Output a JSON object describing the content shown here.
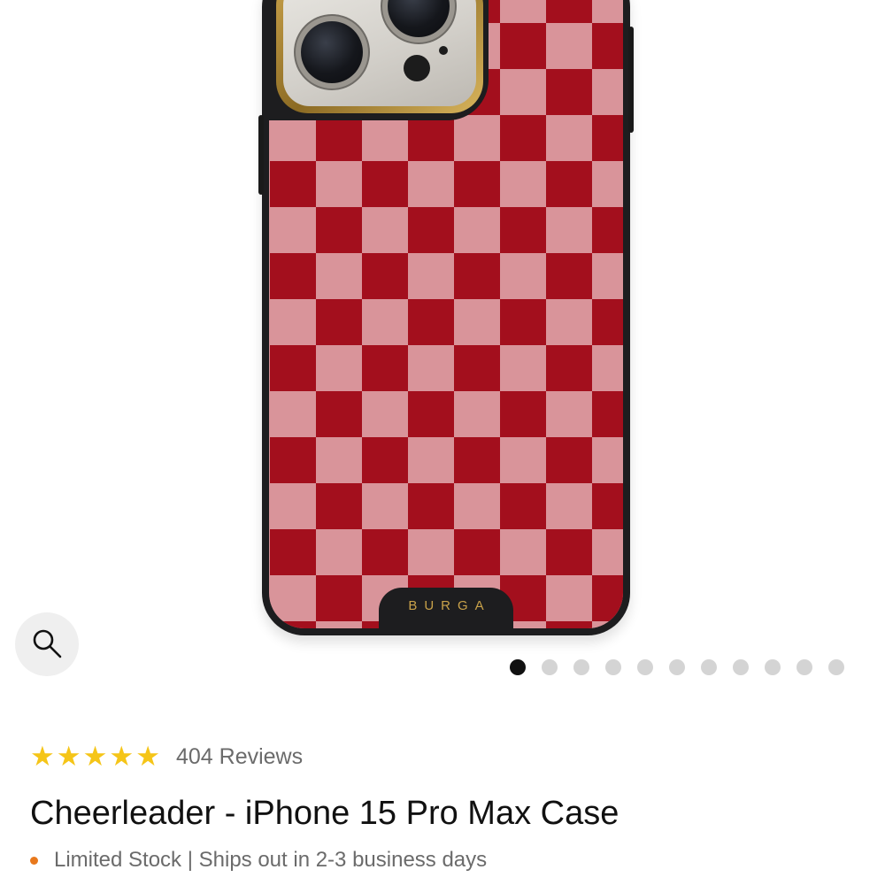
{
  "product": {
    "brand_logo": "BURGA",
    "checker_colors": {
      "dark": "#a30f1d",
      "light": "#d9949a"
    },
    "camera_ring_color": "#c9a24a"
  },
  "gallery": {
    "zoom_icon": "search-icon",
    "total_images": 11,
    "active_index": 0
  },
  "rating": {
    "stars": 5,
    "star_color": "#f5c518",
    "reviews_label": "404 Reviews"
  },
  "title": "Cheerleader - iPhone 15 Pro Max Case",
  "stock": {
    "indicator_color": "#e8781c",
    "text": "Limited Stock | Ships out in 2-3 business days"
  }
}
